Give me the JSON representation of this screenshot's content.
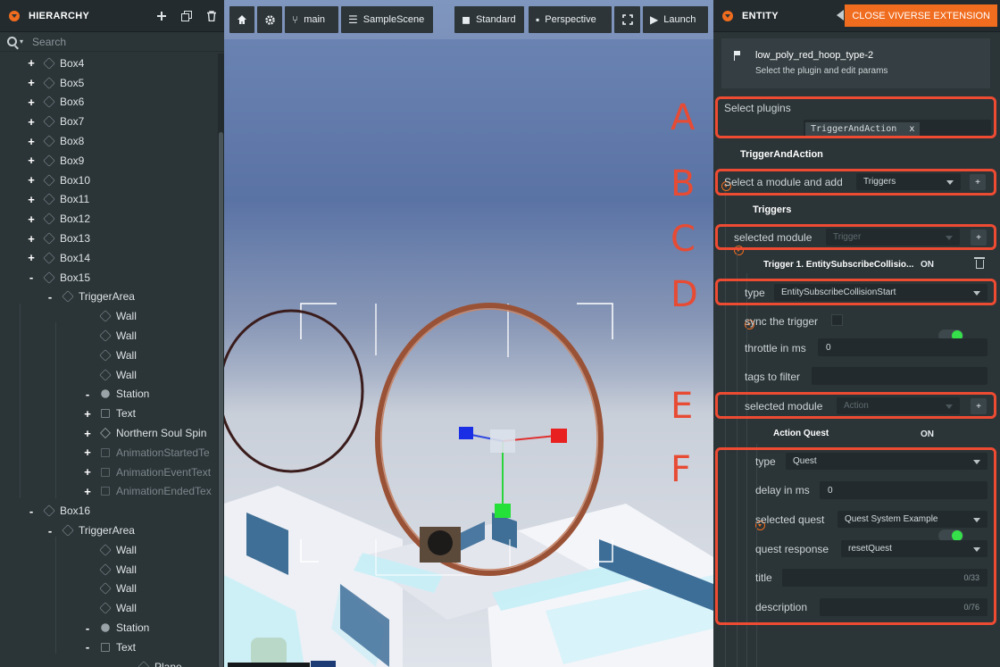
{
  "hierarchy": {
    "title": "HIERARCHY",
    "search_placeholder": "Search",
    "items": [
      {
        "label": "Box4",
        "depth": 0,
        "toggle": "+",
        "icon": "cube-icon",
        "dim": false
      },
      {
        "label": "Box5",
        "depth": 0,
        "toggle": "+",
        "icon": "cube-icon",
        "dim": false
      },
      {
        "label": "Box6",
        "depth": 0,
        "toggle": "+",
        "icon": "cube-icon",
        "dim": false
      },
      {
        "label": "Box7",
        "depth": 0,
        "toggle": "+",
        "icon": "cube-icon",
        "dim": false
      },
      {
        "label": "Box8",
        "depth": 0,
        "toggle": "+",
        "icon": "cube-icon",
        "dim": false
      },
      {
        "label": "Box9",
        "depth": 0,
        "toggle": "+",
        "icon": "cube-icon",
        "dim": false
      },
      {
        "label": "Box10",
        "depth": 0,
        "toggle": "+",
        "icon": "cube-icon",
        "dim": false
      },
      {
        "label": "Box11",
        "depth": 0,
        "toggle": "+",
        "icon": "cube-icon",
        "dim": false
      },
      {
        "label": "Box12",
        "depth": 0,
        "toggle": "+",
        "icon": "cube-icon",
        "dim": false
      },
      {
        "label": "Box13",
        "depth": 0,
        "toggle": "+",
        "icon": "cube-icon",
        "dim": false
      },
      {
        "label": "Box14",
        "depth": 0,
        "toggle": "+",
        "icon": "cube-icon",
        "dim": false
      },
      {
        "label": "Box15",
        "depth": 0,
        "toggle": "-",
        "icon": "cube-icon",
        "dim": false
      },
      {
        "label": "TriggerArea",
        "depth": 1,
        "toggle": "-",
        "icon": "cube-icon",
        "dim": false
      },
      {
        "label": "Wall",
        "depth": 2,
        "toggle": "",
        "icon": "cube-icon",
        "dim": false
      },
      {
        "label": "Wall",
        "depth": 2,
        "toggle": "",
        "icon": "cube-icon",
        "dim": false
      },
      {
        "label": "Wall",
        "depth": 2,
        "toggle": "",
        "icon": "cube-icon",
        "dim": false
      },
      {
        "label": "Wall",
        "depth": 2,
        "toggle": "",
        "icon": "cube-icon",
        "dim": false
      },
      {
        "label": "Station",
        "depth": 2,
        "toggle": "-",
        "icon": "sphere-icon",
        "dim": false
      },
      {
        "label": "Text",
        "depth": 3,
        "toggle": "+",
        "icon": "text-icon",
        "dim": false
      },
      {
        "label": "Northern Soul Spin",
        "depth": 3,
        "toggle": "+",
        "icon": "diamond-icon",
        "dim": false
      },
      {
        "label": "AnimationStartedTe",
        "depth": 3,
        "toggle": "+",
        "icon": "text-icon",
        "dim": true
      },
      {
        "label": "AnimationEventText",
        "depth": 3,
        "toggle": "+",
        "icon": "text-icon",
        "dim": true
      },
      {
        "label": "AnimationEndedTex",
        "depth": 3,
        "toggle": "+",
        "icon": "text-icon",
        "dim": true
      },
      {
        "label": "Box16",
        "depth": 0,
        "toggle": "-",
        "icon": "cube-icon",
        "dim": false
      },
      {
        "label": "TriggerArea",
        "depth": 1,
        "toggle": "-",
        "icon": "cube-icon",
        "dim": false
      },
      {
        "label": "Wall",
        "depth": 2,
        "toggle": "",
        "icon": "cube-icon",
        "dim": false
      },
      {
        "label": "Wall",
        "depth": 2,
        "toggle": "",
        "icon": "cube-icon",
        "dim": false
      },
      {
        "label": "Wall",
        "depth": 2,
        "toggle": "",
        "icon": "cube-icon",
        "dim": false
      },
      {
        "label": "Wall",
        "depth": 2,
        "toggle": "",
        "icon": "cube-icon",
        "dim": false
      },
      {
        "label": "Station",
        "depth": 2,
        "toggle": "-",
        "icon": "sphere-icon",
        "dim": false
      },
      {
        "label": "Text",
        "depth": 3,
        "toggle": "-",
        "icon": "text-icon",
        "dim": false
      },
      {
        "label": "Plane",
        "depth": 4,
        "toggle": "",
        "icon": "cube-icon",
        "dim": false
      }
    ]
  },
  "toolbar": {
    "main_label": "main",
    "scene_label": "SampleScene",
    "standard_label": "Standard",
    "perspective_label": "Perspective",
    "launch_label": "Launch"
  },
  "entity": {
    "title": "ENTITY",
    "close_label": "CLOSE VIVERSE EXTENSION",
    "object_name": "low_poly_red_hoop_type-2",
    "object_hint": "Select the plugin and edit params",
    "select_plugins_label": "Select plugins",
    "plugin_tag": "TriggerAndAction",
    "plugin_tag_remove": "x",
    "plugin_section": "TriggerAndAction",
    "module_add_label": "Select a module and add",
    "module_add_value": "Triggers",
    "add_glyph": "+",
    "triggers_section": "Triggers",
    "selected_module_label": "selected module",
    "trigger_placeholder": "Trigger",
    "trigger_title": "Trigger 1. EntitySubscribeCollisio...",
    "on_label": "ON",
    "type_label": "type",
    "trigger_type": "EntitySubscribeCollisionStart",
    "sync_label": "sync the trigger",
    "throttle_label": "throttle in ms",
    "throttle_value": "0",
    "tags_label": "tags to filter",
    "action_placeholder": "Action",
    "action_title": "Action Quest",
    "action_type": "Quest",
    "delay_label": "delay in ms",
    "delay_value": "0",
    "quest_label": "selected quest",
    "quest_value": "Quest System Example",
    "response_label": "quest response",
    "response_value": "resetQuest",
    "title_label": "title",
    "title_counter": "0/33",
    "description_label": "description",
    "description_counter": "0/76"
  },
  "annotations": {
    "a": "A",
    "b": "B",
    "c": "C",
    "d": "D",
    "e": "E",
    "f": "F",
    "color": "#ee4b33"
  },
  "colors": {
    "accent": "#f06c1e",
    "panel_bg": "#2b3437",
    "toggle_on": "#35e04a",
    "hoop": "#b06a4c"
  }
}
